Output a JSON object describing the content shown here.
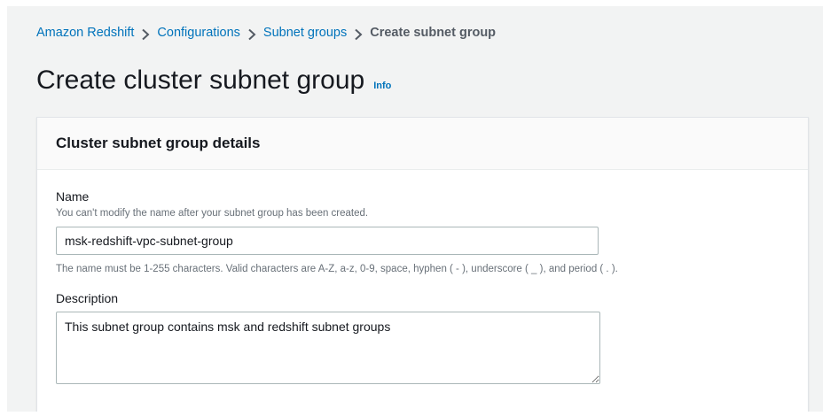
{
  "breadcrumb": {
    "items": [
      {
        "label": "Amazon Redshift"
      },
      {
        "label": "Configurations"
      },
      {
        "label": "Subnet groups"
      }
    ],
    "current": "Create subnet group"
  },
  "page": {
    "title": "Create cluster subnet group",
    "info_label": "Info"
  },
  "panel": {
    "title": "Cluster subnet group details",
    "name_field": {
      "label": "Name",
      "description": "You can't modify the name after your subnet group has been created.",
      "value": "msk-redshift-vpc-subnet-group",
      "constraint": "The name must be 1-255 characters. Valid characters are A-Z, a-z, 0-9, space, hyphen ( - ), underscore ( _ ), and period ( . )."
    },
    "description_field": {
      "label": "Description",
      "value": "This subnet group contains msk and redshift subnet groups"
    }
  },
  "colors": {
    "link": "#0073bb",
    "background": "#f2f3f3",
    "text": "#16191f",
    "hint": "#687078"
  }
}
